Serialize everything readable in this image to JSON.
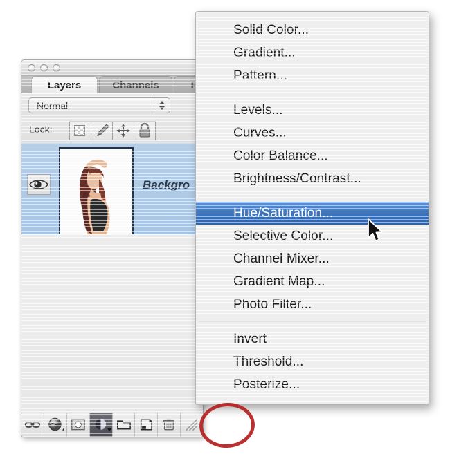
{
  "palette": {
    "window_controls": [
      "close",
      "minimize",
      "zoom"
    ],
    "tabs": [
      {
        "label": "Layers",
        "active": true
      },
      {
        "label": "Channels",
        "active": false
      },
      {
        "label": "Paths",
        "active": false
      }
    ],
    "blend_mode": {
      "value": "Normal",
      "stepper": "up-down-arrows"
    },
    "lock": {
      "label": "Lock:",
      "options": [
        {
          "name": "lock-transparent-pixels",
          "icon": "checkerboard-icon"
        },
        {
          "name": "lock-image-pixels",
          "icon": "paintbrush-icon"
        },
        {
          "name": "lock-position",
          "icon": "move-cross-icon"
        },
        {
          "name": "lock-all",
          "icon": "padlock-icon"
        }
      ]
    },
    "layer_row": {
      "visibility_icon": "eye-icon",
      "thumbnail": "layer-thumbnail-woman",
      "name": "Backgro"
    },
    "bottom_buttons": [
      {
        "name": "link-layers-button",
        "icon": "chain-link-icon",
        "pressed": false
      },
      {
        "name": "layer-style-button",
        "icon": "fx-icon",
        "pressed": false
      },
      {
        "name": "add-layer-mask-button",
        "icon": "mask-circle-icon",
        "pressed": false
      },
      {
        "name": "new-adjustment-layer-button",
        "icon": "half-filled-circle-icon",
        "pressed": true
      },
      {
        "name": "new-group-button",
        "icon": "folder-icon",
        "pressed": false
      },
      {
        "name": "new-layer-button",
        "icon": "new-page-icon",
        "pressed": false
      },
      {
        "name": "delete-layer-button",
        "icon": "trash-icon",
        "pressed": false
      },
      {
        "name": "resize-grip",
        "icon": "resize-grip-icon",
        "pressed": false
      }
    ]
  },
  "menu": {
    "name": "new-adjustment-layer-menu",
    "groups": [
      {
        "items": [
          {
            "label": "Solid Color...",
            "selected": false
          },
          {
            "label": "Gradient...",
            "selected": false
          },
          {
            "label": "Pattern...",
            "selected": false
          }
        ]
      },
      {
        "items": [
          {
            "label": "Levels...",
            "selected": false
          },
          {
            "label": "Curves...",
            "selected": false
          },
          {
            "label": "Color Balance...",
            "selected": false
          },
          {
            "label": "Brightness/Contrast...",
            "selected": false
          }
        ]
      },
      {
        "items": [
          {
            "label": "Hue/Saturation...",
            "selected": true
          },
          {
            "label": "Selective Color...",
            "selected": false
          },
          {
            "label": "Channel Mixer...",
            "selected": false
          },
          {
            "label": "Gradient Map...",
            "selected": false
          },
          {
            "label": "Photo Filter...",
            "selected": false
          }
        ]
      },
      {
        "items": [
          {
            "label": "Invert",
            "selected": false
          },
          {
            "label": "Threshold...",
            "selected": false
          },
          {
            "label": "Posterize...",
            "selected": false
          }
        ]
      }
    ]
  },
  "annotations": {
    "highlight_ellipse": {
      "name": "red-callout-ellipse",
      "color": "#b42020"
    },
    "cursor": {
      "name": "mouse-pointer",
      "type": "arrow"
    }
  },
  "colors": {
    "menu_highlight": "#3e7bc9",
    "layer_selected": "#a8c9ec",
    "annotation_red": "#b42020"
  }
}
